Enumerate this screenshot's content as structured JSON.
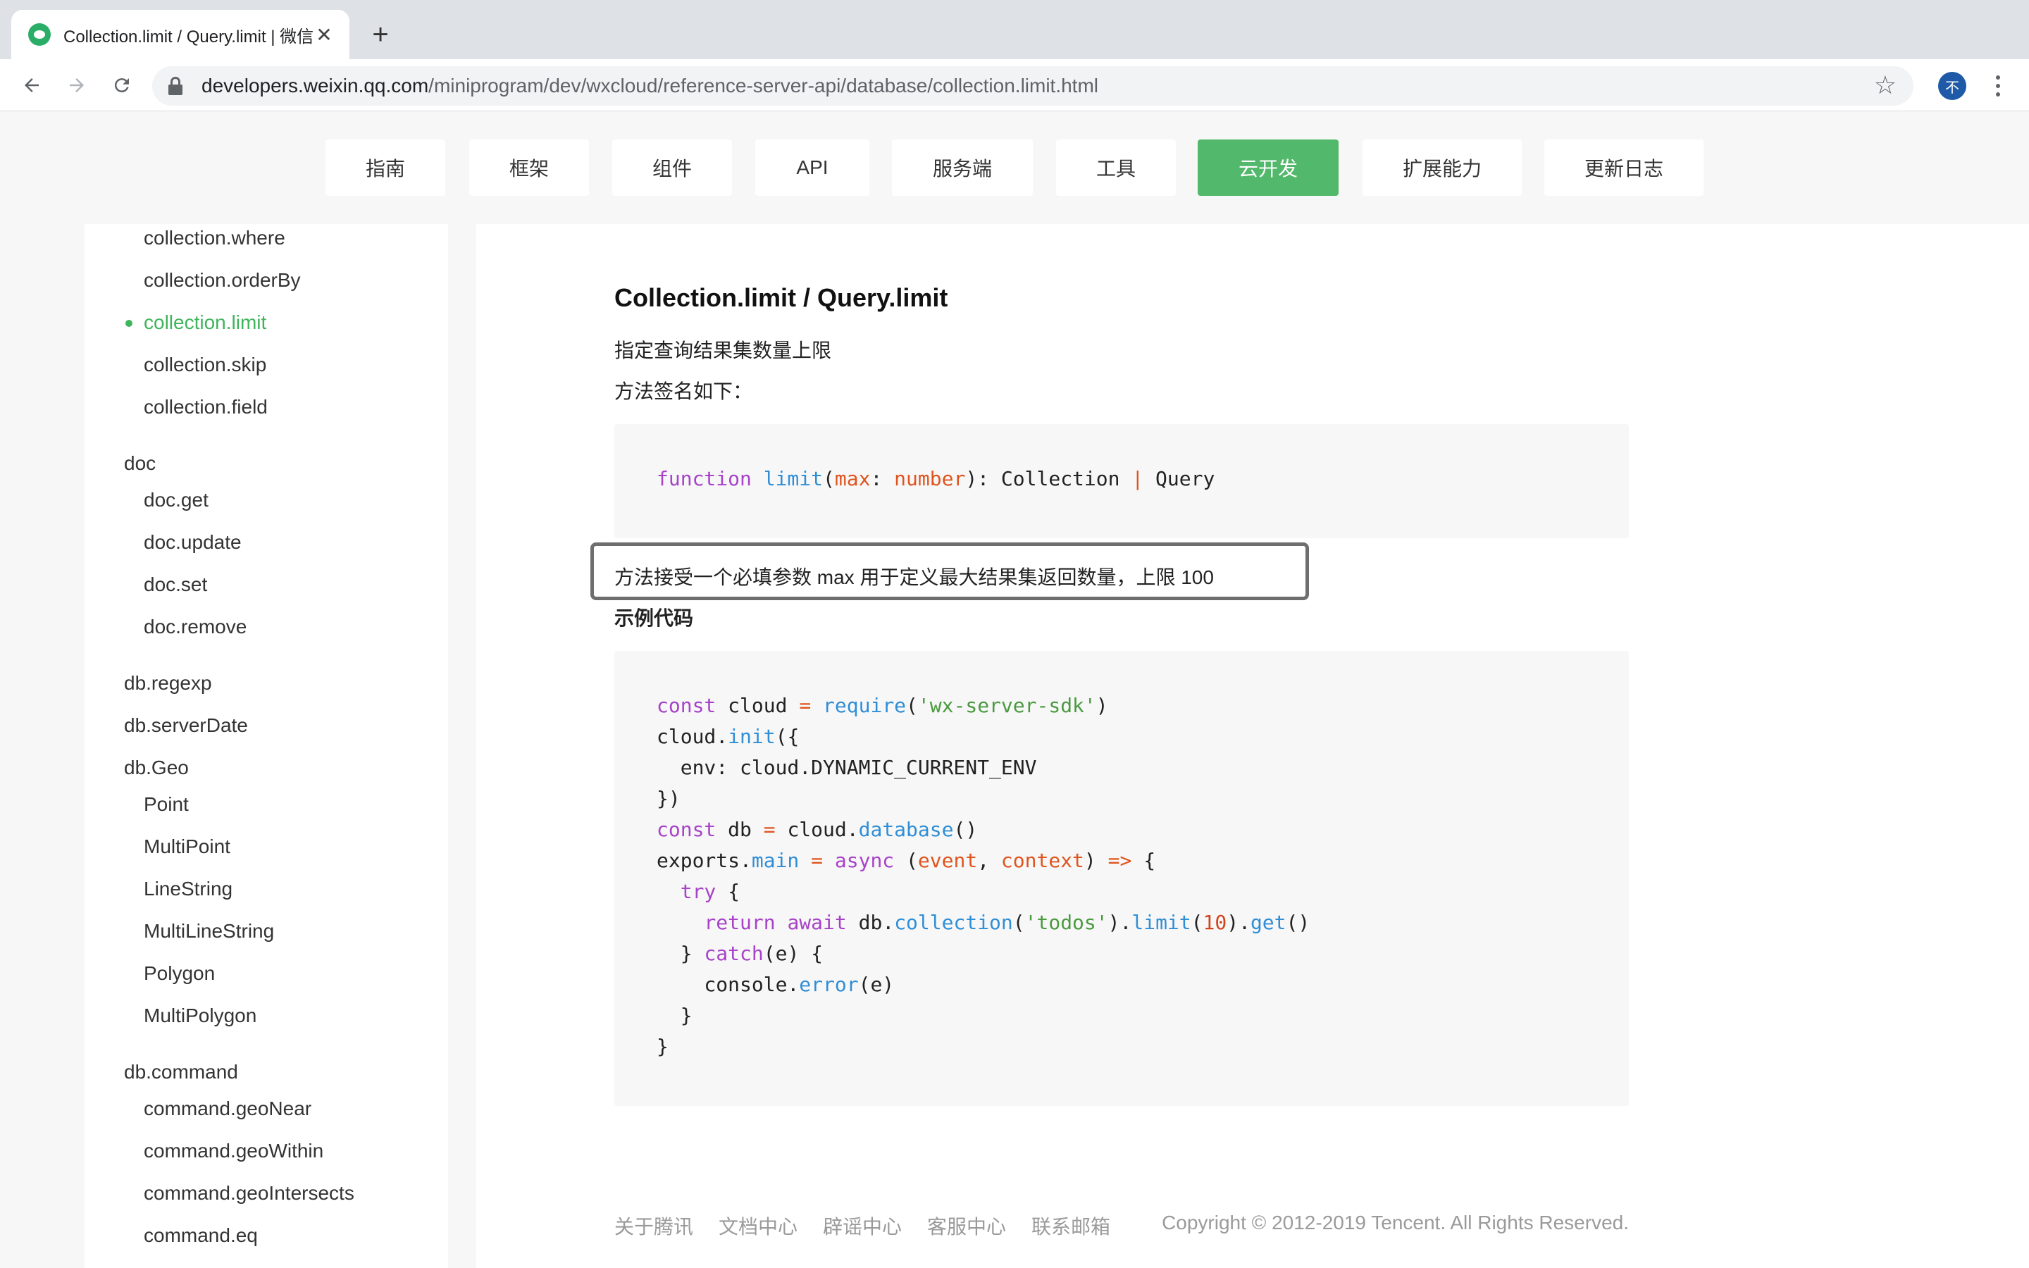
{
  "browser": {
    "tab_title": "Collection.limit / Query.limit | 微信开放文档",
    "tab_close": "✕",
    "new_tab": "+",
    "url_host": "developers.weixin.qq.com",
    "url_path": "/miniprogram/dev/wxcloud/reference-server-api/database/collection.limit.html",
    "avatar_letter": "不",
    "icons": [
      "back-arrow-icon",
      "forward-arrow-icon",
      "reload-icon",
      "lock-icon",
      "star-icon",
      "kebab-menu-icon"
    ]
  },
  "site_nav": {
    "items": [
      {
        "label": "指南"
      },
      {
        "label": "框架"
      },
      {
        "label": "组件"
      },
      {
        "label": "API"
      },
      {
        "label": "服务端"
      },
      {
        "label": "工具"
      },
      {
        "label": "云开发",
        "active": true
      },
      {
        "label": "扩展能力"
      },
      {
        "label": "更新日志"
      }
    ],
    "active_color": "#52b86b"
  },
  "sidebar": {
    "items": [
      {
        "label": "collection.where"
      },
      {
        "label": "collection.orderBy"
      },
      {
        "label": "collection.limit",
        "active": true
      },
      {
        "label": "collection.skip"
      },
      {
        "label": "collection.field"
      },
      {
        "label": "doc"
      },
      {
        "label": "doc.get"
      },
      {
        "label": "doc.update"
      },
      {
        "label": "doc.set"
      },
      {
        "label": "doc.remove"
      },
      {
        "label": "db.regexp"
      },
      {
        "label": "db.serverDate"
      },
      {
        "label": "db.Geo"
      },
      {
        "label": "Point"
      },
      {
        "label": "MultiPoint"
      },
      {
        "label": "LineString"
      },
      {
        "label": "MultiLineString"
      },
      {
        "label": "Polygon"
      },
      {
        "label": "MultiPolygon"
      },
      {
        "label": "db.command"
      },
      {
        "label": "command.geoNear"
      },
      {
        "label": "command.geoWithin"
      },
      {
        "label": "command.geoIntersects"
      },
      {
        "label": "command.eq"
      }
    ]
  },
  "content": {
    "title": "Collection.limit / Query.limit",
    "description": "指定查询结果集数量上限",
    "signature_label": "方法签名如下：",
    "signature_code": "function limit(max: number): Collection | Query",
    "param_note": "方法接受一个必填参数 max 用于定义最大结果集返回数量，上限 100",
    "example_heading": "示例代码",
    "example_code": [
      "const cloud = require('wx-server-sdk')",
      "cloud.init({",
      "  env: cloud.DYNAMIC_CURRENT_ENV",
      "})",
      "const db = cloud.database()",
      "exports.main = async (event, context) => {",
      "  try {",
      "    return await db.collection('todos').limit(10).get()",
      "  } catch(e) {",
      "    console.error(e)",
      "  }",
      "}"
    ]
  },
  "footer": {
    "links": [
      {
        "label": "关于腾讯"
      },
      {
        "label": "文档中心"
      },
      {
        "label": "辟谣中心"
      },
      {
        "label": "客服中心"
      },
      {
        "label": "联系邮箱"
      }
    ],
    "copyright": "Copyright © 2012-2019 Tencent. All Rights Reserved."
  }
}
